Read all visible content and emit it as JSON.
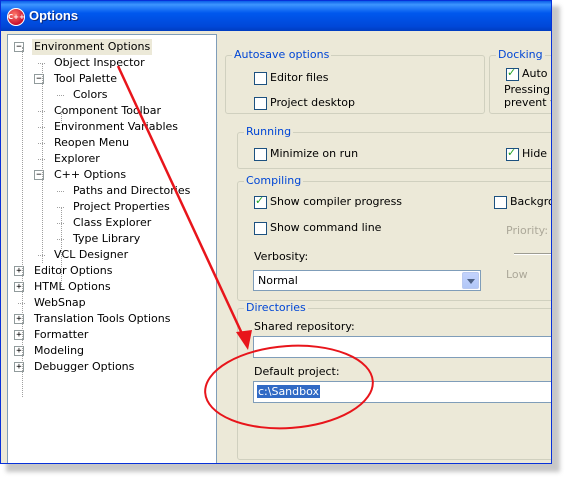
{
  "window": {
    "title": "Options",
    "app_icon_text": "C++"
  },
  "tree": [
    {
      "label": "Environment Options",
      "level": 0,
      "expander": "−",
      "selected": true
    },
    {
      "label": "Object Inspector",
      "level": 1
    },
    {
      "label": "Tool Palette",
      "level": 1,
      "expander": "−"
    },
    {
      "label": "Colors",
      "level": 2
    },
    {
      "label": "Component Toolbar",
      "level": 1
    },
    {
      "label": "Environment Variables",
      "level": 1
    },
    {
      "label": "Reopen Menu",
      "level": 1
    },
    {
      "label": "Explorer",
      "level": 1
    },
    {
      "label": "C++ Options",
      "level": 1,
      "expander": "−"
    },
    {
      "label": "Paths and Directories",
      "level": 2
    },
    {
      "label": "Project Properties",
      "level": 2
    },
    {
      "label": "Class Explorer",
      "level": 2
    },
    {
      "label": "Type Library",
      "level": 2
    },
    {
      "label": "VCL Designer",
      "level": 1
    },
    {
      "label": "Editor Options",
      "level": 0,
      "expander": "+"
    },
    {
      "label": "HTML Options",
      "level": 0,
      "expander": "+"
    },
    {
      "label": "WebSnap",
      "level": 0
    },
    {
      "label": "Translation Tools Options",
      "level": 0,
      "expander": "+"
    },
    {
      "label": "Formatter",
      "level": 0,
      "expander": "+"
    },
    {
      "label": "Modeling",
      "level": 0,
      "expander": "+"
    },
    {
      "label": "Debugger Options",
      "level": 0,
      "expander": "+"
    }
  ],
  "autosave": {
    "title": "Autosave options",
    "editor_files": "Editor files",
    "project_desktop": "Project desktop"
  },
  "docking": {
    "title": "Docking",
    "auto": "Auto d",
    "text_line1": "Pressing t",
    "text_line2": "prevent w"
  },
  "running": {
    "title": "Running",
    "minimize": "Minimize on run",
    "hide": "Hide d"
  },
  "compiling": {
    "title": "Compiling",
    "show_progress": "Show compiler progress",
    "show_command_line": "Show command line",
    "background": "Backgrou",
    "priority": "Priority:",
    "low": "Low",
    "verbosity_label": "Verbosity:",
    "verbosity_value": "Normal"
  },
  "directories": {
    "title": "Directories",
    "shared_repository": "Shared repository:",
    "shared_value": "",
    "default_project": "Default project:",
    "default_value": "c:\\Sandbox"
  },
  "annotation": {
    "color": "#e8151b"
  }
}
